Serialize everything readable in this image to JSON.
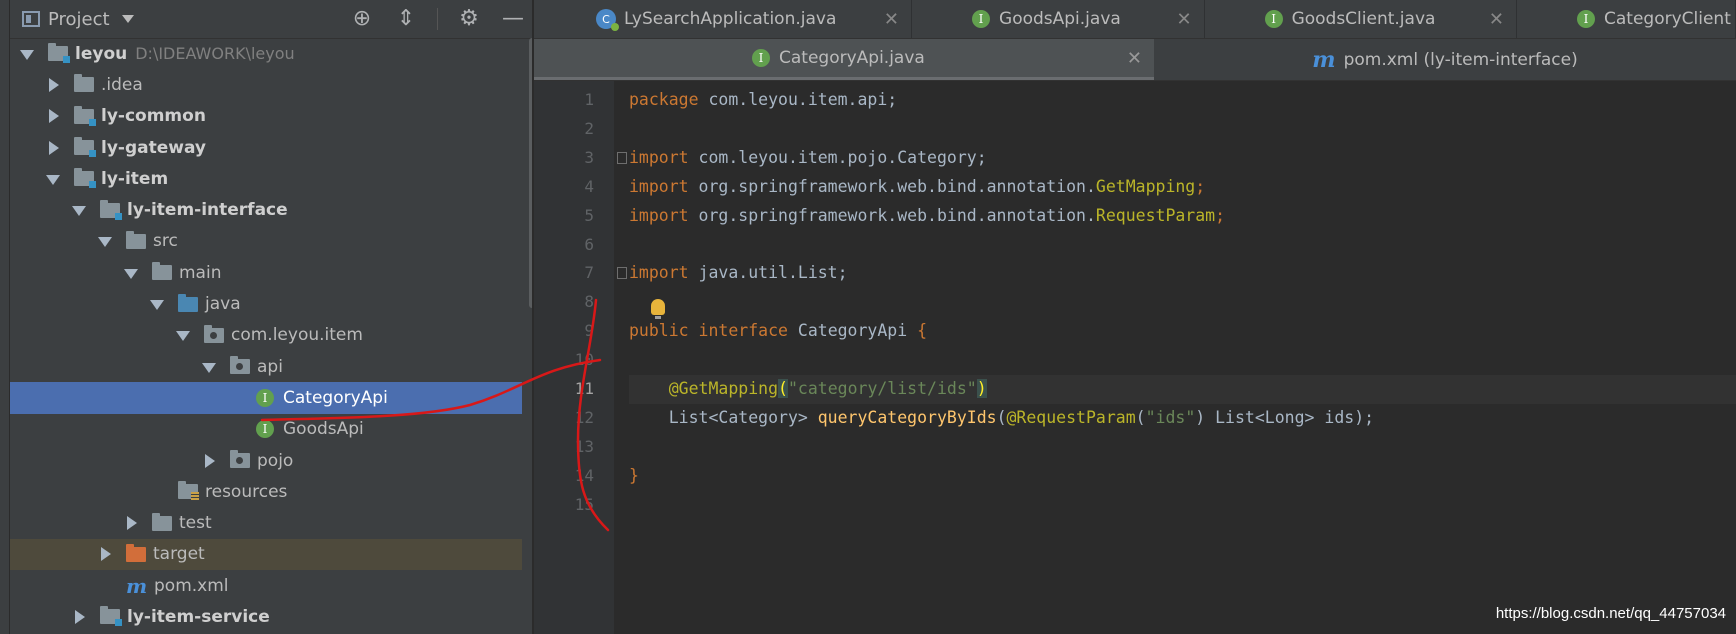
{
  "project_panel": {
    "title": "Project",
    "tools": [
      "locate-icon",
      "collapse-all-icon",
      "gear-icon",
      "hide-icon"
    ],
    "tree": [
      {
        "label": "leyou",
        "path": "D:\\IDEAWORK\\leyou",
        "arrow": "down",
        "icon": "module",
        "bold": true
      },
      {
        "label": ".idea",
        "arrow": "right",
        "icon": "folder"
      },
      {
        "label": "ly-common",
        "arrow": "right",
        "icon": "module",
        "bold": true
      },
      {
        "label": "ly-gateway",
        "arrow": "right",
        "icon": "module",
        "bold": true
      },
      {
        "label": "ly-item",
        "arrow": "down",
        "icon": "module",
        "bold": true
      },
      {
        "label": "ly-item-interface",
        "arrow": "down",
        "icon": "module",
        "bold": true
      },
      {
        "label": "src",
        "arrow": "down",
        "icon": "folder"
      },
      {
        "label": "main",
        "arrow": "down",
        "icon": "folder"
      },
      {
        "label": "java",
        "arrow": "down",
        "icon": "source"
      },
      {
        "label": "com.leyou.item",
        "arrow": "down",
        "icon": "package"
      },
      {
        "label": "api",
        "arrow": "down",
        "icon": "package"
      },
      {
        "label": "CategoryApi",
        "arrow": "none",
        "icon": "interface",
        "selected": true
      },
      {
        "label": "GoodsApi",
        "arrow": "none",
        "icon": "interface"
      },
      {
        "label": "pojo",
        "arrow": "right",
        "icon": "package"
      },
      {
        "label": "resources",
        "arrow": "none",
        "icon": "resources"
      },
      {
        "label": "test",
        "arrow": "right",
        "icon": "folder"
      },
      {
        "label": "target",
        "arrow": "right",
        "icon": "target",
        "excluded": true
      },
      {
        "label": "pom.xml",
        "arrow": "none",
        "icon": "maven"
      },
      {
        "label": "ly-item-service",
        "arrow": "right",
        "icon": "module",
        "bold": true
      }
    ]
  },
  "editor": {
    "tabs_row1": [
      {
        "label": "LySearchApplication.java",
        "icon": "app"
      },
      {
        "label": "GoodsApi.java",
        "icon": "interface"
      },
      {
        "label": "GoodsClient.java",
        "icon": "interface"
      },
      {
        "label": "CategoryClient",
        "icon": "interface"
      }
    ],
    "tabs_row2": [
      {
        "label": "CategoryApi.java",
        "icon": "interface",
        "active": true
      },
      {
        "label": "pom.xml (ly-item-interface)",
        "icon": "maven"
      }
    ],
    "current_line": 11,
    "code_lines": [
      [
        [
          "kw",
          "package "
        ],
        [
          "t",
          "com.leyou.item.api;"
        ]
      ],
      [],
      [
        [
          "kw",
          "import "
        ],
        [
          "t",
          "com.leyou.item.pojo.Category;"
        ]
      ],
      [
        [
          "kw",
          "import "
        ],
        [
          "t",
          "org.springframework.web.bind.annotation."
        ],
        [
          "ann",
          "GetMapping"
        ],
        [
          "kw",
          ";"
        ]
      ],
      [
        [
          "kw",
          "import "
        ],
        [
          "t",
          "org.springframework.web.bind.annotation."
        ],
        [
          "ann",
          "RequestParam"
        ],
        [
          "kw",
          ";"
        ]
      ],
      [],
      [
        [
          "kw",
          "import "
        ],
        [
          "t",
          "java.util.List;"
        ]
      ],
      [],
      [
        [
          "kw",
          "public interface "
        ],
        [
          "t",
          "CategoryApi "
        ],
        [
          "kw",
          "{"
        ]
      ],
      [],
      [
        [
          "t",
          "    "
        ],
        [
          "ann",
          "@GetMapping"
        ],
        [
          "bh",
          "("
        ],
        [
          "str",
          "\"category/list/ids\""
        ],
        [
          "bh",
          ")"
        ]
      ],
      [
        [
          "t",
          "    List<Category> "
        ],
        [
          "fn",
          "queryCategoryByIds"
        ],
        [
          "t",
          "("
        ],
        [
          "ann",
          "@RequestParam"
        ],
        [
          "t",
          "("
        ],
        [
          "str",
          "\"ids\""
        ],
        [
          "t",
          ") List<Long> ids);"
        ]
      ],
      [],
      [
        [
          "kw",
          "}"
        ]
      ],
      []
    ]
  },
  "watermark": "https://blog.csdn.net/qq_44757034"
}
